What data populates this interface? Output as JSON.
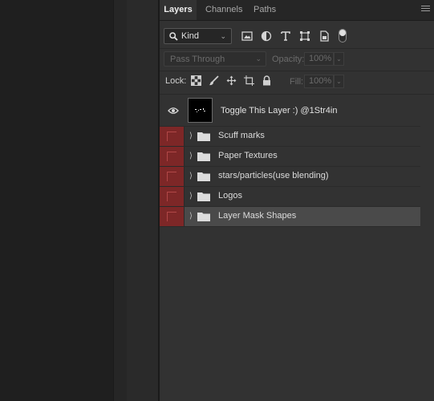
{
  "tabs": [
    {
      "label": "Layers",
      "active": true
    },
    {
      "label": "Channels",
      "active": false
    },
    {
      "label": "Paths",
      "active": false
    }
  ],
  "filter": {
    "kind_label": "Kind",
    "icons": [
      "image-filter-icon",
      "adjustment-filter-icon",
      "type-filter-icon",
      "shape-filter-icon",
      "smart-object-filter-icon"
    ]
  },
  "blend": {
    "mode": "Pass Through",
    "opacity_label": "Opacity:",
    "opacity_value": "100%"
  },
  "lock": {
    "label": "Lock:",
    "fill_label": "Fill:",
    "fill_value": "100%"
  },
  "top_layer": {
    "name": "Toggle This Layer :)  @1Str4in"
  },
  "groups": [
    {
      "name": "Scuff marks"
    },
    {
      "name": "Paper Textures"
    },
    {
      "name": "stars/particles(use blending)"
    },
    {
      "name": "Logos"
    },
    {
      "name": "Layer Mask Shapes",
      "selected": true
    }
  ],
  "colors": {
    "hidden_layer_marker": "#7d2727",
    "panel_bg": "#323232",
    "selected_row": "#4a4a4a"
  }
}
